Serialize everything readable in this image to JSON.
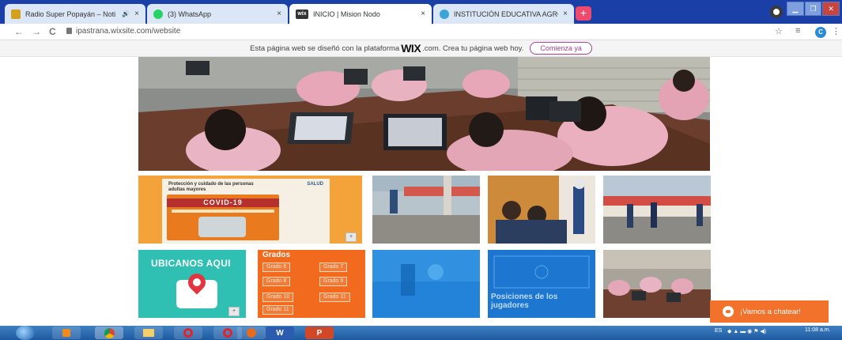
{
  "browser": {
    "tabs": [
      {
        "title": "Radio Super Popayán – Noti",
        "favicon_color": "#d4a11e",
        "audio": "🔊"
      },
      {
        "title": "(3) WhatsApp",
        "favicon_color": "#25d366"
      },
      {
        "title": "INICIO | Mision Nodo",
        "favicon_color": "#333333",
        "favicon_text": "wix"
      },
      {
        "title": "INSTITUCIÓN EDUCATIVA AGRO",
        "favicon_color": "#3aa6d8"
      }
    ],
    "close_glyph": "×",
    "new_tab_glyph": "+",
    "url": "ipastrana.wixsite.com/website",
    "window_controls": [
      "▁",
      "❐",
      "✕"
    ],
    "back_glyph": "←",
    "forward_glyph": "→",
    "reload_glyph": "C",
    "star_glyph": "☆",
    "reading_list_glyph": "≡",
    "account_letter": "C",
    "menu_glyph": "⋮"
  },
  "wix_banner": {
    "text_before": "Esta página web se diseñó con la plataforma",
    "logo": "WIX",
    "text_after": ".com. Crea tu página web hoy.",
    "cta_label": "Comienza ya"
  },
  "covid_tile": {
    "heading": "Protección y cuidado de las personas adultas mayores",
    "logo": "SALUD",
    "band": "COVID-19",
    "expand_glyph": "+"
  },
  "ubicanos_tile": {
    "title": "UBICANOS AQUI",
    "expand_glyph": "+"
  },
  "grados_tile": {
    "title": "Grados",
    "buttons": [
      "Grado 6",
      "Grado 7",
      "Grado 8",
      "Grado 9",
      "Grado 10",
      "Grado 11"
    ],
    "extra": "Grado 11"
  },
  "blue_tile": {
    "caption": "Posiciones de los jugadores"
  },
  "chat": {
    "label": "¡Vamos a chatear!"
  },
  "taskbar": {
    "apps": [
      "",
      "",
      "",
      "",
      "",
      "",
      "",
      "W",
      "P"
    ],
    "tray_lang": "ES",
    "clock": "11:08 a.m."
  },
  "colors": {
    "tab_strip": "#1a3fa6",
    "wix_accent": "#a14592",
    "chat_orange": "#f2712b",
    "grados_orange": "#f26a1e",
    "ubicanos_teal": "#2fbfb3"
  }
}
